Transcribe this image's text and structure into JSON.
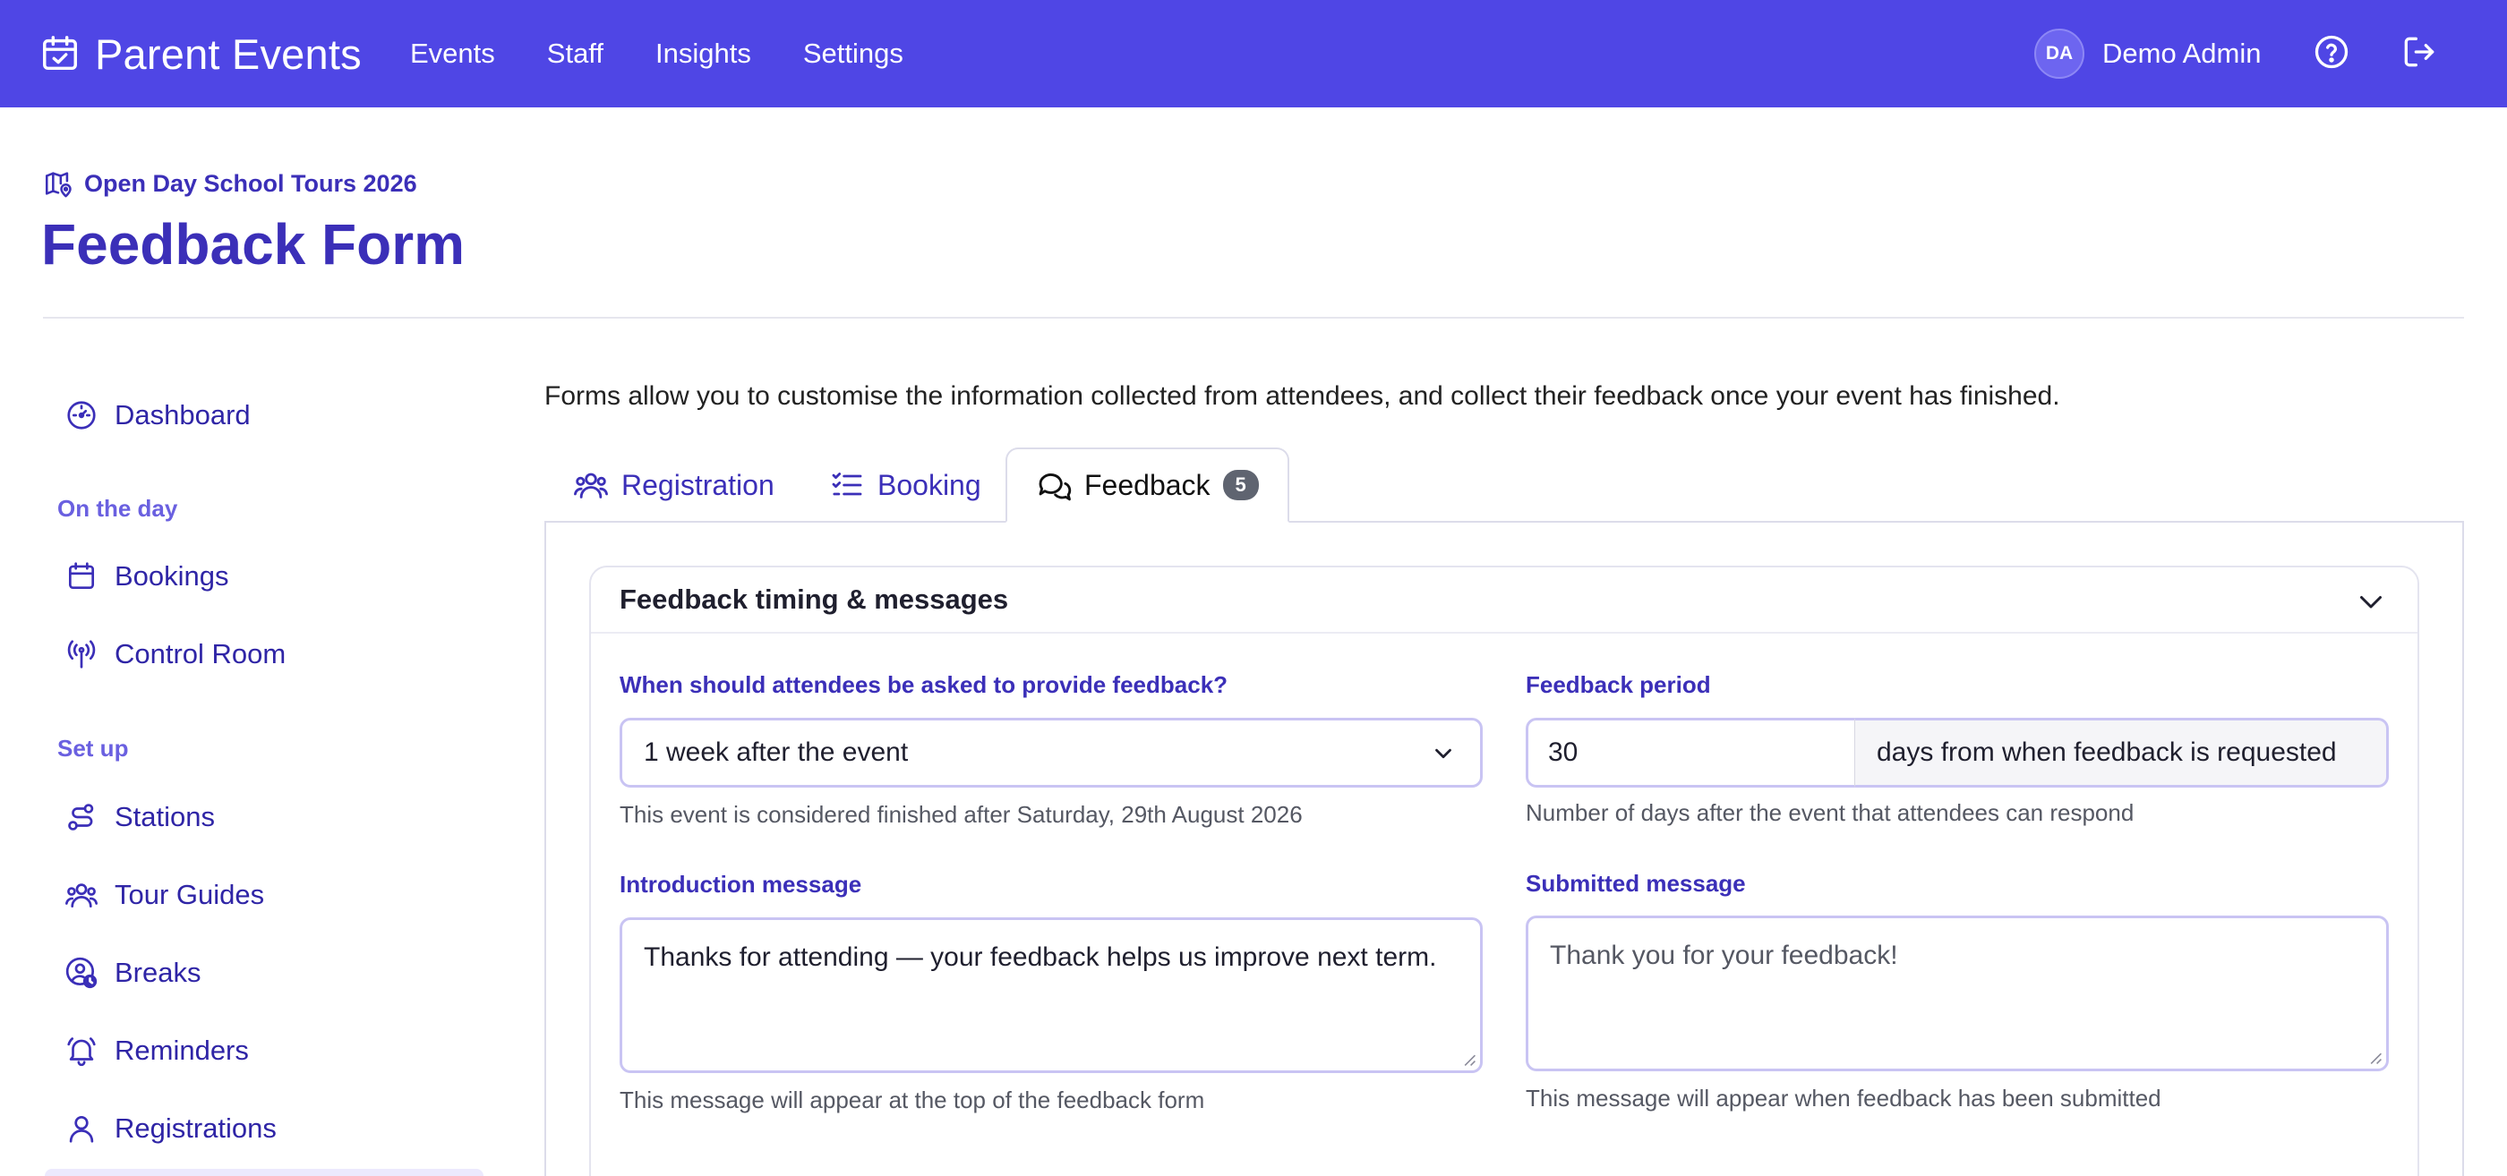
{
  "app": {
    "brand": "Parent Events",
    "nav": [
      "Events",
      "Staff",
      "Insights",
      "Settings"
    ],
    "user": {
      "initials": "DA",
      "name": "Demo Admin"
    },
    "icons": {
      "brand": "calendar-check-icon",
      "help": "help-circle-icon",
      "logout": "logout-icon"
    },
    "accent": "#4f46e5"
  },
  "header": {
    "breadcrumb": "Open Day School Tours 2026",
    "title": "Feedback Form"
  },
  "sidebar": {
    "dashboard": "Dashboard",
    "section_on_the_day": "On the day",
    "bookings": "Bookings",
    "control_room": "Control Room",
    "section_set_up": "Set up",
    "stations": "Stations",
    "tour_guides": "Tour Guides",
    "breaks": "Breaks",
    "reminders": "Reminders",
    "registrations": "Registrations"
  },
  "main": {
    "intro": "Forms allow you to customise the information collected from attendees, and collect their feedback once your event has finished.",
    "tabs": {
      "registration": "Registration",
      "booking": "Booking",
      "feedback": "Feedback",
      "feedback_count": "5"
    },
    "card": {
      "title": "Feedback timing & messages",
      "timing_label": "When should attendees be asked to provide feedback?",
      "timing_value": "1 week after the event",
      "timing_help": "This event is considered finished after Saturday, 29th August 2026",
      "period_label": "Feedback period",
      "period_value": "30",
      "period_suffix": "days from when feedback is requested",
      "period_help": "Number of days after the event that attendees can respond",
      "intro_label": "Introduction message",
      "intro_value": "Thanks for attending — your feedback helps us improve next term.",
      "intro_help": "This message will appear at the top of the feedback form",
      "submitted_label": "Submitted message",
      "submitted_placeholder": "Thank you for your feedback!",
      "submitted_help": "This message will appear when feedback has been submitted"
    }
  }
}
